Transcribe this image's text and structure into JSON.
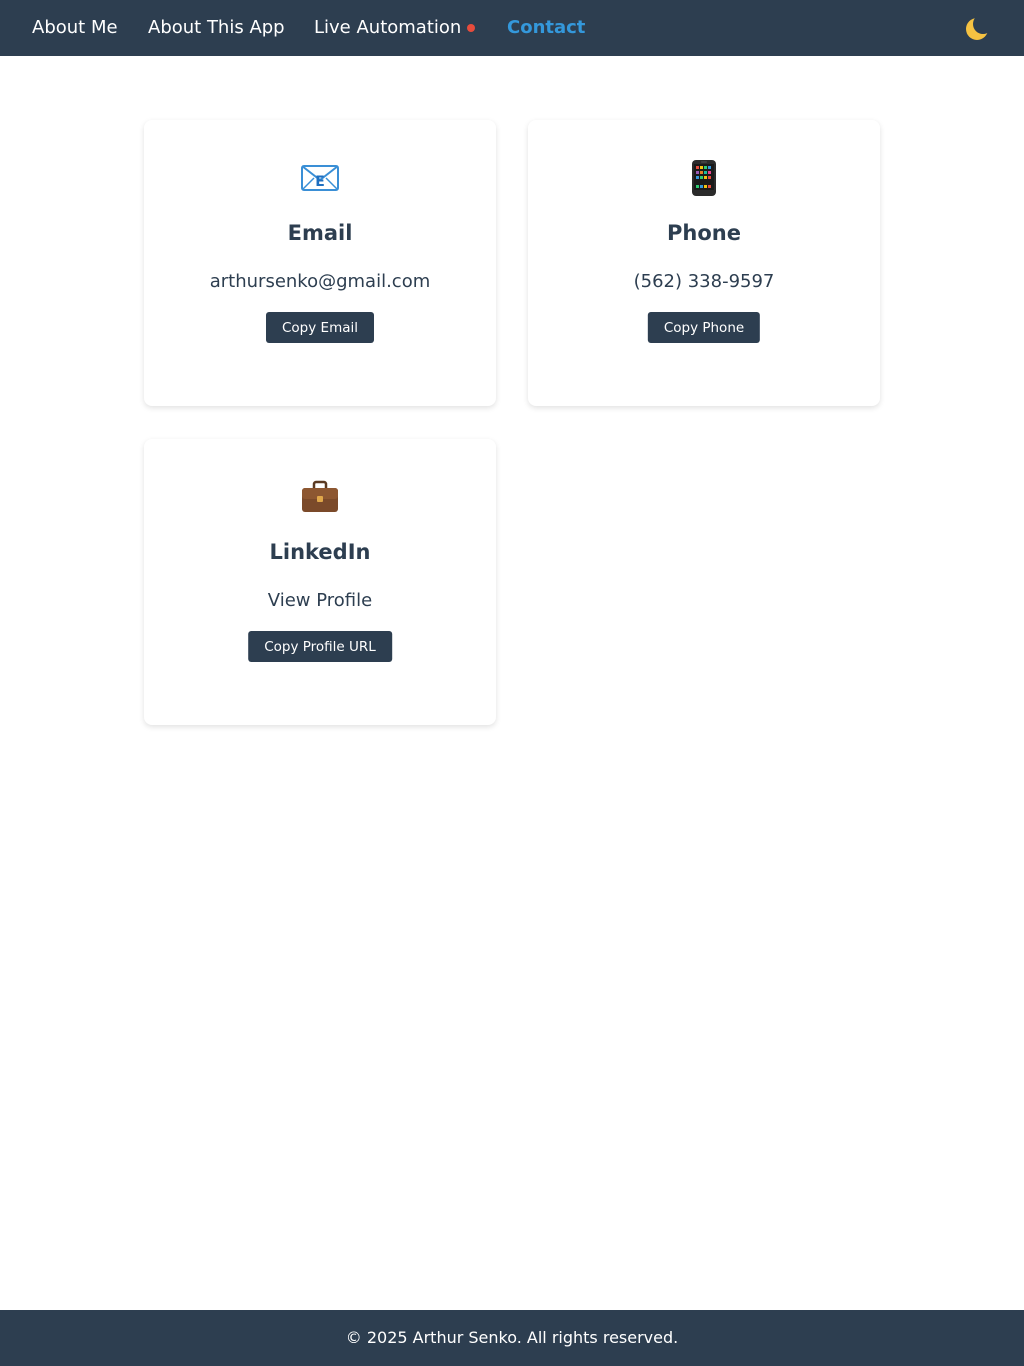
{
  "nav": {
    "items": [
      {
        "label": "About Me"
      },
      {
        "label": "About This App"
      },
      {
        "label": "Live Automation"
      },
      {
        "label": "Contact"
      }
    ],
    "active": "Contact",
    "live_indicator_color": "#e74c3c",
    "theme_toggle_icon": "moon-icon"
  },
  "cards": [
    {
      "icon": "envelope-icon",
      "title": "Email",
      "value": "arthursenko@gmail.com",
      "button": "Copy Email"
    },
    {
      "icon": "mobile-phone-icon",
      "title": "Phone",
      "value": "(562) 338-9597",
      "button": "Copy Phone"
    },
    {
      "icon": "briefcase-icon",
      "title": "LinkedIn",
      "value": "View Profile",
      "button": "Copy Profile URL"
    }
  ],
  "footer": {
    "text": "© 2025 Arthur Senko. All rights reserved."
  },
  "colors": {
    "nav_background": "#2d3e50",
    "accent": "#3498db",
    "button_background": "#2d3e50",
    "text": "#2d3e50"
  }
}
